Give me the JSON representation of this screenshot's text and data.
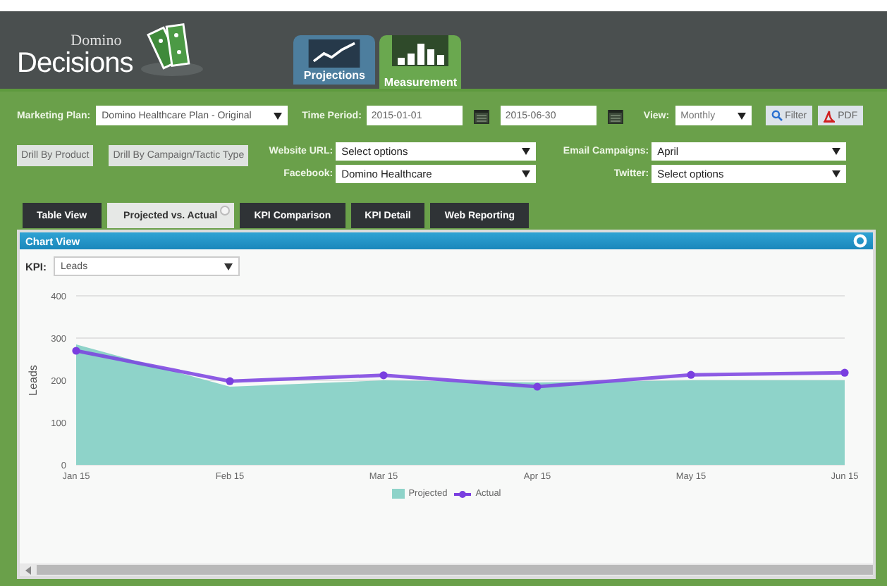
{
  "brand": {
    "line1": "Domino",
    "line2": "Decisions"
  },
  "nav": [
    {
      "label": "Projections",
      "kind": "line",
      "selected": false
    },
    {
      "label": "Measurement",
      "kind": "bars",
      "selected": true
    }
  ],
  "filters": {
    "marketing_plan": {
      "label": "Marketing Plan:",
      "value": "Domino Healthcare Plan - Original"
    },
    "time_period": {
      "label": "Time Period:",
      "start": "2015-01-01",
      "end": "2015-06-30"
    },
    "view": {
      "label": "View:",
      "value": "Monthly"
    },
    "filter_button": "Filter",
    "pdf_button": "PDF"
  },
  "drill_buttons": [
    "Drill By Product",
    "Drill By Campaign/Tactic Type"
  ],
  "selects": [
    {
      "label": "Website URL:",
      "value": "Select options"
    },
    {
      "label": "Email Campaigns:",
      "value": "April"
    },
    {
      "label": "Facebook:",
      "value": "Domino Healthcare"
    },
    {
      "label": "Twitter:",
      "value": "Select options"
    }
  ],
  "tabs": [
    {
      "label": "Table View",
      "selected": false
    },
    {
      "label": "Projected vs. Actual",
      "selected": true
    },
    {
      "label": "KPI Comparison",
      "selected": false
    },
    {
      "label": "KPI Detail",
      "selected": false
    },
    {
      "label": "Web Reporting",
      "selected": false
    }
  ],
  "panel": {
    "title": "Chart View",
    "kpi_label": "KPI:",
    "kpi_value": "Leads",
    "chart_data": {
      "type": "area",
      "legend": "bottom",
      "ylabel": "Leads",
      "categories": [
        "Jan 15",
        "Feb 15",
        "Mar 15",
        "Apr 15",
        "May 15",
        "Jun 15"
      ],
      "ylim": [
        0,
        400
      ],
      "yticks": [
        0,
        100,
        200,
        300,
        400
      ],
      "series": [
        {
          "name": "Projected",
          "color": "#8ed3c9",
          "type": "area",
          "values": [
            285,
            185,
            200,
            195,
            200,
            200
          ]
        },
        {
          "name": "Actual",
          "color": "#7a3fe0",
          "type": "line",
          "marker": "circle",
          "values": [
            270,
            198,
            212,
            185,
            213,
            218
          ]
        }
      ]
    }
  }
}
